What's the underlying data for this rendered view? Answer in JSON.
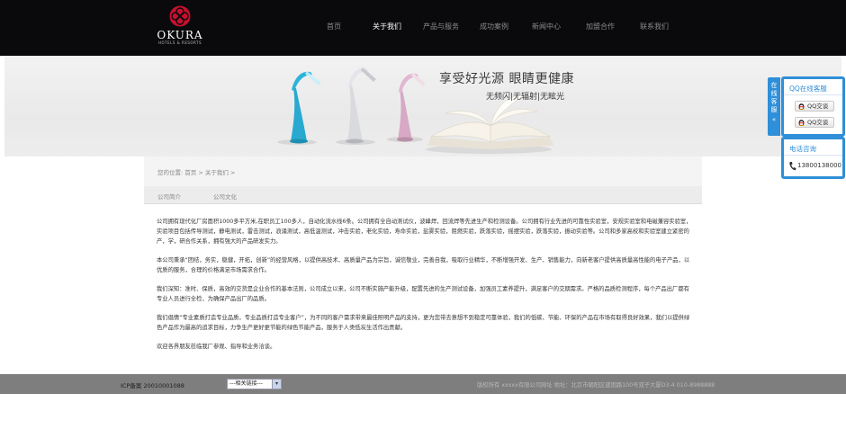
{
  "logo": {
    "brand": "OKURA",
    "sub": "HOTELS & RESORTS"
  },
  "nav": {
    "items": [
      {
        "label": "首页",
        "active": false
      },
      {
        "label": "关于我们",
        "active": true
      },
      {
        "label": "产品与服务",
        "active": false
      },
      {
        "label": "成功案例",
        "active": false
      },
      {
        "label": "新闻中心",
        "active": false
      },
      {
        "label": "加盟合作",
        "active": false
      },
      {
        "label": "联系我们",
        "active": false
      }
    ]
  },
  "banner": {
    "slogan": "享受好光源 眼睛更健康",
    "tagline": "无频闪|无辐射|无眩光"
  },
  "breadcrumb": {
    "text": "您的位置: 首页 > 关于我们 >"
  },
  "subnav": {
    "items": [
      "公司简介",
      "公司文化"
    ]
  },
  "content": {
    "paragraphs": [
      "公司拥有现代化厂房面积1000多平方米,在职员工100多人，自动化流水线6条。公司拥有全自动测试仪，波峰焊，回流焊等先进生产和检测设备。公司拥有行业先进的可靠性实验室，安规实验室和电磁兼容实验室，实验项目包括传导测试，静电测试，雷击测试，浪涌测试，高低温测试，冲击实验，老化实验，寿命实验，盐雾实验，阻燃实验，跌落实验，摇摆实验，跌落实验，振动实验等。公司和多家高校和实验室建立紧密的产，学，研合作关系，拥有强大的产品研发实力。",
      "本公司秉承“团结，务实，稳健，开拓，创新”的经营风格，以提供高技术、高质量产品为宗旨，诚信敬业，完善自我，吸取行业精华，不断增强开发、生产、销售能力，向新老客户提供高质量高性能的电子产品，以优质的服务，合理的价格满足市场需求合作。",
      "我们深知：准时、保质，高效的交货是企业合作的基本法则，公司成立以来，公司不断实施产能升级，配置先进的生产测试设备，加强员工素养提升，满足客户的交期需求。严格的品质检测程序，每个产品出厂都有专业人员进行全检，为确保产品出厂的品质。",
      "我们倡情“专业素质打造专业品质，专业品质打造专业客户”，为不同的客户需求带来最佳照明产品的支持，更为您带去意想不到稳定可靠体验，我们的低碳、节能、环保的产品在市场有取得良好效果，我们以提供绿色产品作为最高的追求目标，力争生产更好更节能的绿色节能产品，服务于人类低炭生活作出贡献。",
      "欢迎各界朋友莅临我厂参观、指导和业务洽谈。"
    ]
  },
  "footer": {
    "icp": "ICP备案 20010001088",
    "select_value": "---相关链接---",
    "copyright": "版权所有 xxxxx有限公司网址 地址：北京市朝阳区建国路100号双子大厦D3-4 010-8988888"
  },
  "service": {
    "tab_label": "在线客服",
    "qq_title": "QQ在线客服",
    "qq_buttons": [
      "QQ交谈",
      "QQ交谈"
    ],
    "tel_title": "电话咨询",
    "tel_number": "13800138000"
  },
  "colors": {
    "header_bg": "#0a0a0d",
    "accent": "#2f8fd8",
    "footer_bg": "#7e7e7e",
    "logo_red": "#c8102e"
  }
}
